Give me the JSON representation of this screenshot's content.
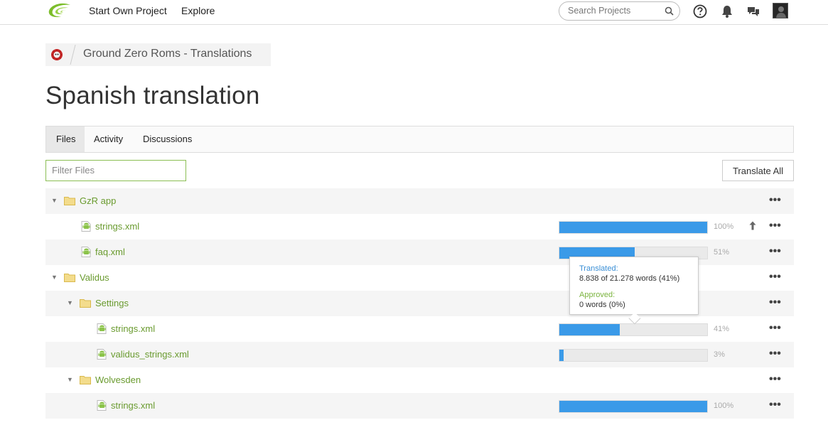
{
  "header": {
    "nav": [
      "Start Own Project",
      "Explore"
    ],
    "search_placeholder": "Search Projects",
    "icons": [
      "help-icon",
      "bell-icon",
      "chat-icon"
    ]
  },
  "breadcrumb": {
    "project": "Ground Zero Roms - Translations"
  },
  "page_title": "Spanish translation",
  "tabs": [
    {
      "label": "Files",
      "active": true
    },
    {
      "label": "Activity",
      "active": false
    },
    {
      "label": "Discussions",
      "active": false
    }
  ],
  "filter_placeholder": "Filter Files",
  "translate_all_label": "Translate All",
  "colors": {
    "accent_green": "#6a9b2f",
    "progress_blue": "#3a9ae8"
  },
  "tree": [
    {
      "type": "folder",
      "name": "GzR app",
      "depth": 0
    },
    {
      "type": "file",
      "name": "strings.xml",
      "depth": 1,
      "progress": 100,
      "percent_label": "100%",
      "upload": true
    },
    {
      "type": "file",
      "name": "faq.xml",
      "depth": 1,
      "progress": 51,
      "percent_label": "51%"
    },
    {
      "type": "folder",
      "name": "Validus",
      "depth": 0
    },
    {
      "type": "folder",
      "name": "Settings",
      "depth": 1
    },
    {
      "type": "file",
      "name": "strings.xml",
      "depth": 2,
      "progress": 41,
      "percent_label": "41%"
    },
    {
      "type": "file",
      "name": "validus_strings.xml",
      "depth": 2,
      "progress": 3,
      "percent_label": "3%"
    },
    {
      "type": "folder",
      "name": "Wolvesden",
      "depth": 1
    },
    {
      "type": "file",
      "name": "strings.xml",
      "depth": 2,
      "progress": 100,
      "percent_label": "100%"
    }
  ],
  "tooltip": {
    "translated_label": "Translated:",
    "translated_value": "8.838 of 21.278 words (41%)",
    "approved_label": "Approved:",
    "approved_value": "0 words (0%)"
  },
  "row_menu": "•••"
}
